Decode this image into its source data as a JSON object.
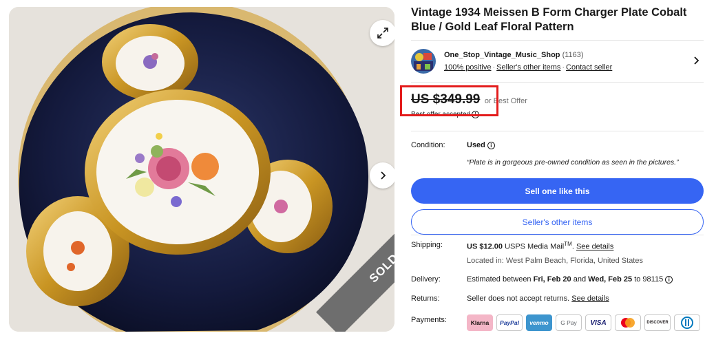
{
  "listing": {
    "title": "Vintage 1934 Meissen B Form Charger Plate Cobalt Blue / Gold Leaf Floral Pattern",
    "sold_label": "SOLD"
  },
  "seller": {
    "name": "One_Stop_Vintage_Music_Shop",
    "feedback_count": "(1163)",
    "positive": "100% positive",
    "other_items_link": "Seller's other items",
    "contact": "Contact seller"
  },
  "price": {
    "amount": "US $349.99",
    "best_offer": "or Best Offer",
    "offer_accepted": "Best offer accepted"
  },
  "condition": {
    "label": "Condition:",
    "value": "Used",
    "note": "“Plate is in gorgeous pre-owned condition as seen in the pictures.”"
  },
  "buttons": {
    "sell_one": "Sell one like this",
    "seller_items": "Seller's other items"
  },
  "shipping": {
    "label": "Shipping:",
    "cost": "US $12.00",
    "service": "USPS Media Mail",
    "tm": "TM",
    "details_link": "See details",
    "location": "Located in: West Palm Beach, Florida, United States"
  },
  "delivery": {
    "label": "Delivery:",
    "prefix": "Estimated between",
    "start": "Fri, Feb 20",
    "and": "and",
    "end": "Wed, Feb 25",
    "to": "to 98115"
  },
  "returns": {
    "label": "Returns:",
    "text": "Seller does not accept returns.",
    "details_link": "See details"
  },
  "payments": {
    "label": "Payments:",
    "methods": [
      "Klarna",
      "PayPal",
      "venmo",
      "G Pay",
      "VISA",
      "Mastercard",
      "DISCOVER",
      "Diners Club"
    ]
  },
  "colors": {
    "accent": "#3665f3",
    "highlight": "#e31c1c",
    "cobalt": "#141a3d",
    "gold": "#d9a32a"
  }
}
